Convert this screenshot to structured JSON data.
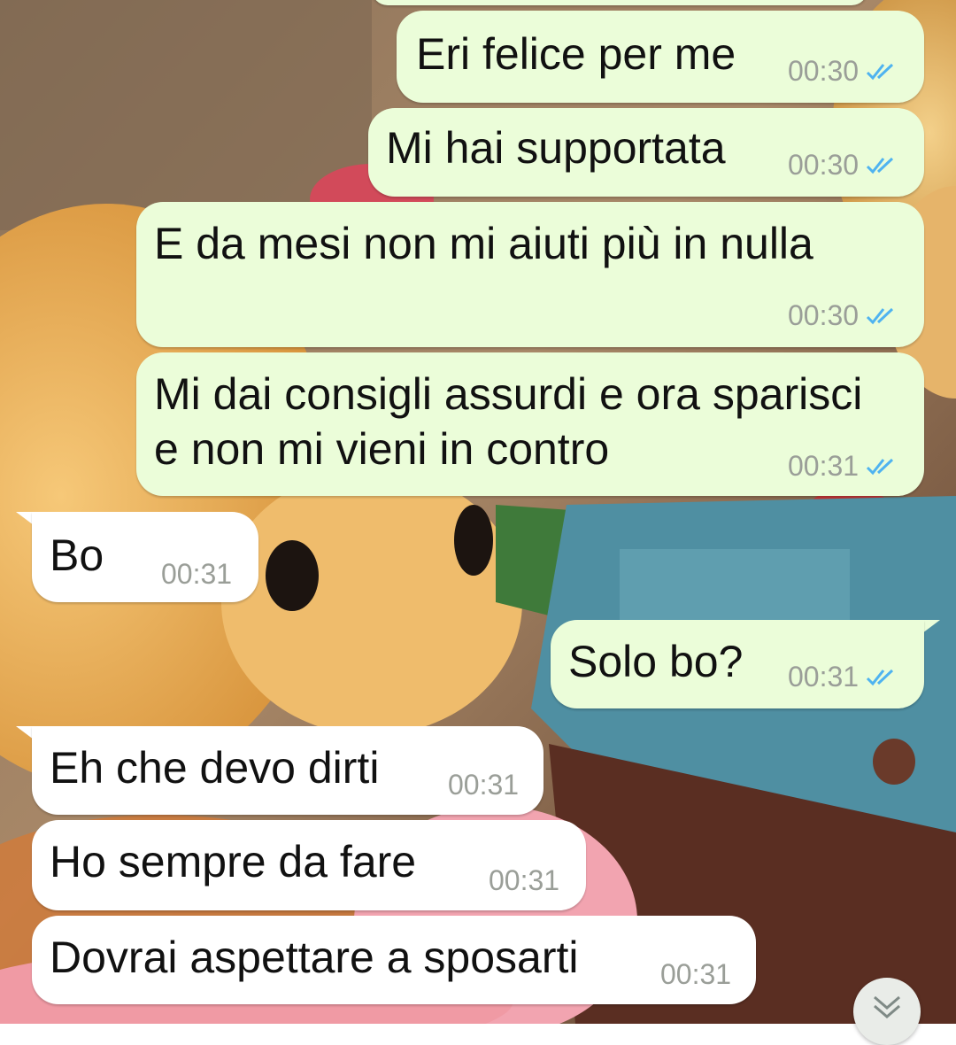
{
  "colors": {
    "outgoing_bubble": "#ebfdd9",
    "incoming_bubble": "#ffffff",
    "read_ticks": "#4fb3f0",
    "timestamp": "#9a9e98"
  },
  "icons": {
    "read_receipt": "double-check-icon",
    "scroll_down": "chevron-double-down-icon"
  },
  "messages": [
    {
      "direction": "outgoing",
      "text": "Eri felice per me",
      "time": "00:30",
      "read": true
    },
    {
      "direction": "outgoing",
      "text": "Mi hai supportata",
      "time": "00:30",
      "read": true
    },
    {
      "direction": "outgoing",
      "text": "E da mesi non mi aiuti più in nulla",
      "time": "00:30",
      "read": true
    },
    {
      "direction": "outgoing",
      "line1": "Mi dai consigli assurdi e ora sparisci",
      "line2": "e non mi vieni in contro",
      "time": "00:31",
      "read": true
    },
    {
      "direction": "incoming",
      "text": "Bo",
      "time": "00:31"
    },
    {
      "direction": "outgoing",
      "text": "Solo bo?",
      "time": "00:31",
      "read": true
    },
    {
      "direction": "incoming",
      "text": "Eh che devo dirti",
      "time": "00:31"
    },
    {
      "direction": "incoming",
      "text": "Ho sempre da fare",
      "time": "00:31"
    },
    {
      "direction": "incoming",
      "text": "Dovrai aspettare a sposarti",
      "time": "00:31"
    }
  ]
}
